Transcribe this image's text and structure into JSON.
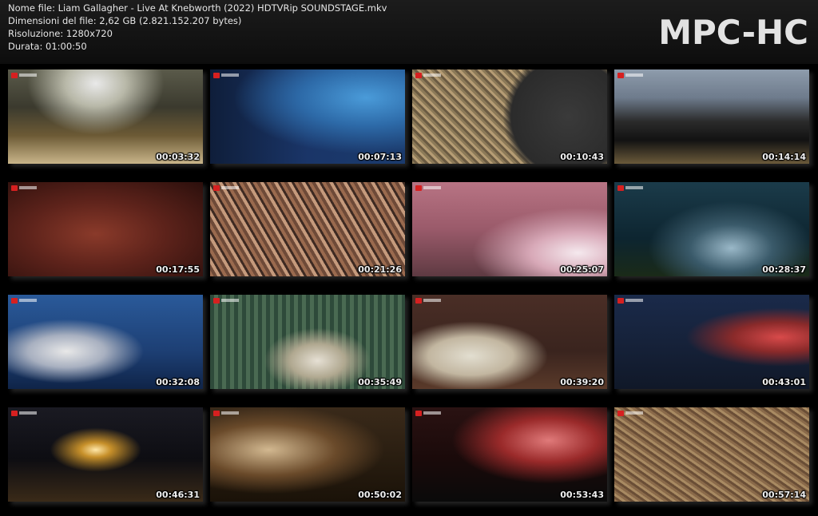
{
  "file_info": {
    "name_line": "Nome file: Liam Gallagher - Live At Knebworth (2022) HDTVRip SOUNDSTAGE.mkv",
    "size_line": "Dimensioni del file: 2,62 GB (2.821.152.207 bytes)",
    "resolution_line": "Risoluzione: 1280x720",
    "duration_line": "Durata: 01:00:50"
  },
  "logo": "MPC-HC",
  "thumbnails": [
    {
      "timestamp": "00:03:32",
      "scene": "s1"
    },
    {
      "timestamp": "00:07:13",
      "scene": "s2"
    },
    {
      "timestamp": "00:10:43",
      "scene": "s3"
    },
    {
      "timestamp": "00:14:14",
      "scene": "s4"
    },
    {
      "timestamp": "00:17:55",
      "scene": "s5"
    },
    {
      "timestamp": "00:21:26",
      "scene": "s6"
    },
    {
      "timestamp": "00:25:07",
      "scene": "s7"
    },
    {
      "timestamp": "00:28:37",
      "scene": "s8"
    },
    {
      "timestamp": "00:32:08",
      "scene": "s9"
    },
    {
      "timestamp": "00:35:49",
      "scene": "s10"
    },
    {
      "timestamp": "00:39:20",
      "scene": "s11"
    },
    {
      "timestamp": "00:43:01",
      "scene": "s12"
    },
    {
      "timestamp": "00:46:31",
      "scene": "s13"
    },
    {
      "timestamp": "00:50:02",
      "scene": "s14"
    },
    {
      "timestamp": "00:53:43",
      "scene": "s15"
    },
    {
      "timestamp": "00:57:14",
      "scene": "s16"
    }
  ]
}
